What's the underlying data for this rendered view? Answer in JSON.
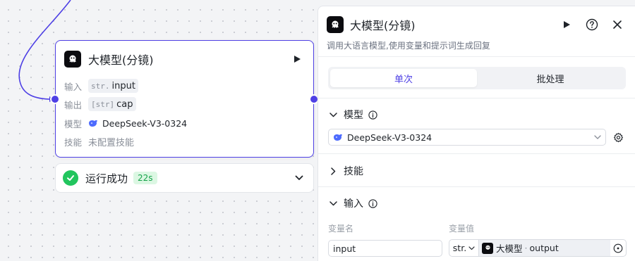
{
  "node": {
    "title": "大模型(分镜)",
    "rows": {
      "input": {
        "label": "输入",
        "type_tag": "str.",
        "value": "input"
      },
      "output": {
        "label": "输出",
        "type_tag": "[str]",
        "value": "cap"
      },
      "model": {
        "label": "模型",
        "value": "DeepSeek-V3-0324"
      },
      "skill": {
        "label": "技能",
        "value": "未配置技能"
      }
    }
  },
  "status": {
    "text": "运行成功",
    "duration": "22s",
    "color": "#22c55e"
  },
  "panel": {
    "title": "大模型(分镜)",
    "description": "调用大语言模型,使用变量和提示词生成回复",
    "tabs": [
      {
        "label": "单次",
        "active": true
      },
      {
        "label": "批处理",
        "active": false
      }
    ],
    "sections": {
      "model": {
        "title": "模型",
        "selected": "DeepSeek-V3-0324"
      },
      "skills": {
        "title": "技能"
      },
      "input": {
        "title": "输入",
        "col_name": "变量名",
        "col_value": "变量值",
        "var_name": "input",
        "var_type": "str.",
        "ref_node": "大模型",
        "ref_sep": "·",
        "ref_var": "output"
      }
    }
  },
  "accent": "#4e40e5",
  "icons": [
    "node-logo-icon",
    "play-icon",
    "help-icon",
    "close-icon",
    "chevron-down-icon",
    "chevron-right-icon",
    "info-icon",
    "gear-icon",
    "whale-icon",
    "check-icon"
  ]
}
